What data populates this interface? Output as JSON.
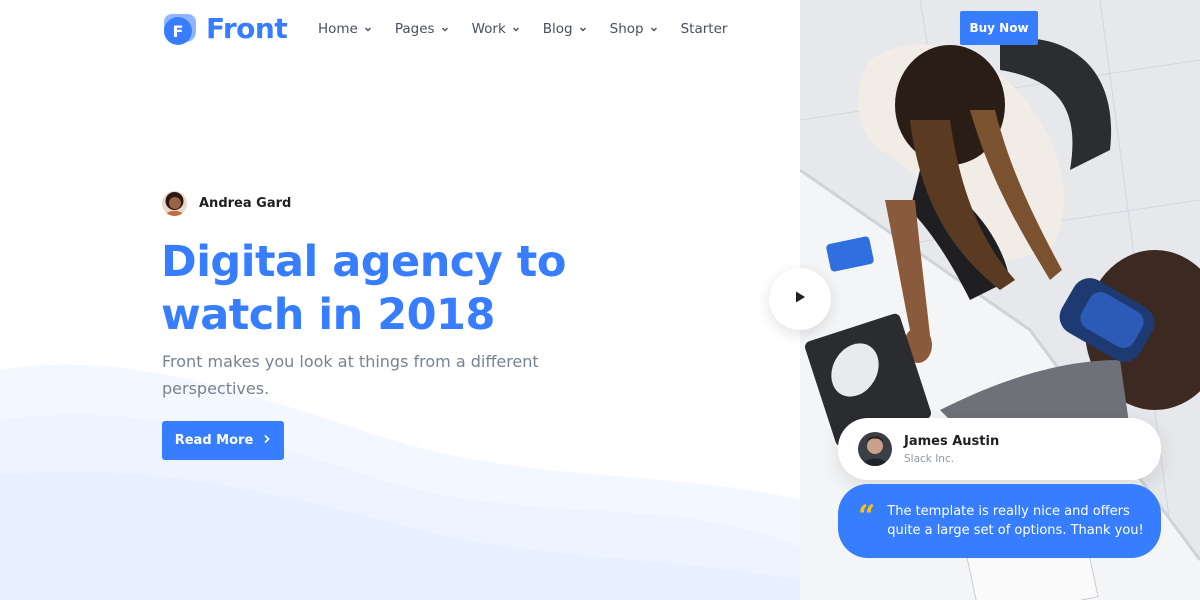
{
  "brand": {
    "name": "Front",
    "logo_letter": "F",
    "accent": "#377dff"
  },
  "nav": {
    "items": [
      {
        "label": "Home",
        "dropdown": true
      },
      {
        "label": "Pages",
        "dropdown": true
      },
      {
        "label": "Work",
        "dropdown": true
      },
      {
        "label": "Blog",
        "dropdown": true
      },
      {
        "label": "Shop",
        "dropdown": true
      },
      {
        "label": "Starter",
        "dropdown": false
      }
    ],
    "cta_label": "Buy Now"
  },
  "hero": {
    "author_name": "Andrea Gard",
    "headline": "Digital agency to watch in 2018",
    "subtext": "Front makes you look at things from a different perspectives.",
    "button_label": "Read More",
    "button_icon": "chevron-right-icon"
  },
  "media": {
    "play_icon": "play-icon"
  },
  "testimonial": {
    "name": "James Austin",
    "company": "Slack Inc.",
    "quote_mark": "“",
    "quote": "The template is really nice and offers quite a large set of options. Thank you!"
  },
  "colors": {
    "accent": "#377dff",
    "quote_mark": "#ffc107",
    "text_dark": "#1e2022",
    "text_muted": "#77838f"
  }
}
